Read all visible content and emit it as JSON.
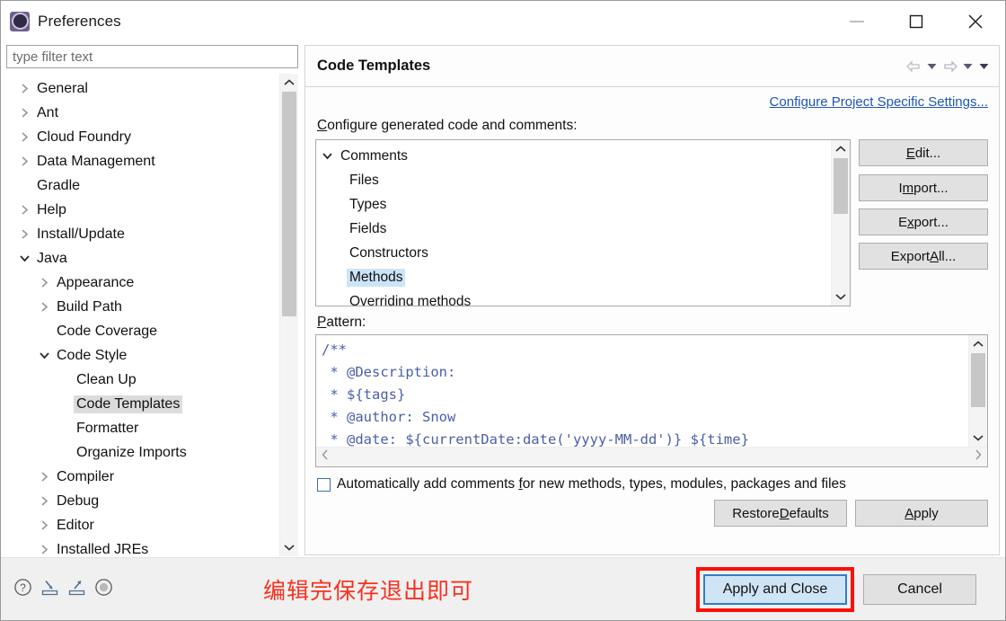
{
  "window": {
    "title": "Preferences",
    "icon": "preferences-gear-icon",
    "controls": {
      "minimize": "minimize-icon",
      "maximize": "maximize-icon",
      "close": "close-icon"
    }
  },
  "filter": {
    "placeholder": "type filter text",
    "value": ""
  },
  "tree": {
    "items": [
      {
        "label": "General",
        "indent": 1,
        "expander": "collapsed",
        "selected": false
      },
      {
        "label": "Ant",
        "indent": 1,
        "expander": "collapsed",
        "selected": false
      },
      {
        "label": "Cloud Foundry",
        "indent": 1,
        "expander": "collapsed",
        "selected": false
      },
      {
        "label": "Data Management",
        "indent": 1,
        "expander": "collapsed",
        "selected": false
      },
      {
        "label": "Gradle",
        "indent": 1,
        "expander": "none",
        "selected": false
      },
      {
        "label": "Help",
        "indent": 1,
        "expander": "collapsed",
        "selected": false
      },
      {
        "label": "Install/Update",
        "indent": 1,
        "expander": "collapsed",
        "selected": false
      },
      {
        "label": "Java",
        "indent": 1,
        "expander": "expanded",
        "selected": false
      },
      {
        "label": "Appearance",
        "indent": 2,
        "expander": "collapsed",
        "selected": false
      },
      {
        "label": "Build Path",
        "indent": 2,
        "expander": "collapsed",
        "selected": false
      },
      {
        "label": "Code Coverage",
        "indent": 2,
        "expander": "none",
        "selected": false
      },
      {
        "label": "Code Style",
        "indent": 2,
        "expander": "expanded",
        "selected": false
      },
      {
        "label": "Clean Up",
        "indent": 3,
        "expander": "none",
        "selected": false
      },
      {
        "label": "Code Templates",
        "indent": 3,
        "expander": "none",
        "selected": true
      },
      {
        "label": "Formatter",
        "indent": 3,
        "expander": "none",
        "selected": false
      },
      {
        "label": "Organize Imports",
        "indent": 3,
        "expander": "none",
        "selected": false
      },
      {
        "label": "Compiler",
        "indent": 2,
        "expander": "collapsed",
        "selected": false
      },
      {
        "label": "Debug",
        "indent": 2,
        "expander": "collapsed",
        "selected": false
      },
      {
        "label": "Editor",
        "indent": 2,
        "expander": "collapsed",
        "selected": false
      },
      {
        "label": "Installed JREs",
        "indent": 2,
        "expander": "collapsed",
        "selected": false
      }
    ]
  },
  "page": {
    "title": "Code Templates",
    "nav_icons": [
      "back-arrow-icon",
      "back-dropdown-icon",
      "forward-arrow-icon",
      "forward-dropdown-icon",
      "view-menu-icon"
    ],
    "project_link": "Configure Project Specific Settings...",
    "section_label_pre": "C",
    "section_label_rest": "onfigure generated code and comments:",
    "templates": [
      {
        "label": "Comments",
        "expander": "expanded",
        "child": false,
        "selected": false
      },
      {
        "label": "Files",
        "expander": "none",
        "child": true,
        "selected": false
      },
      {
        "label": "Types",
        "expander": "none",
        "child": true,
        "selected": false
      },
      {
        "label": "Fields",
        "expander": "none",
        "child": true,
        "selected": false
      },
      {
        "label": "Constructors",
        "expander": "none",
        "child": true,
        "selected": false
      },
      {
        "label": "Methods",
        "expander": "none",
        "child": true,
        "selected": true
      },
      {
        "label": "Overriding methods",
        "expander": "none",
        "child": true,
        "selected": false
      }
    ],
    "buttons": {
      "edit": {
        "pre": "",
        "mnemonic": "E",
        "post": "dit..."
      },
      "import": {
        "pre": "I",
        "mnemonic": "m",
        "post": "port..."
      },
      "export": {
        "pre": "E",
        "mnemonic": "x",
        "post": "port..."
      },
      "export_all": {
        "pre": "Export ",
        "mnemonic": "A",
        "post": "ll..."
      }
    },
    "pattern_label_pre": "P",
    "pattern_label_rest": "attern:",
    "pattern_lines": [
      "/**",
      " * @Description: ",
      " * ${tags}",
      " * @author: Snow",
      " * @date: ${currentDate:date('yyyy-MM-dd')} ${time}"
    ],
    "checkbox": {
      "checked": false,
      "pre": "Automatically add comments ",
      "mnemonic": "f",
      "post": "or new methods, types, modules, packages and files"
    },
    "restore_defaults": {
      "pre": "Restore ",
      "mnemonic": "D",
      "post": "efaults"
    },
    "apply": {
      "pre": "",
      "mnemonic": "A",
      "post": "pply"
    }
  },
  "footer": {
    "icons": [
      "help-icon",
      "import-preferences-icon",
      "export-preferences-icon",
      "about-icon"
    ],
    "annotation": "编辑完保存退出即可",
    "annotation_color": "#f5321e",
    "apply_and_close": "Apply and Close",
    "cancel": "Cancel",
    "highlight_color": "#fb0f08"
  }
}
